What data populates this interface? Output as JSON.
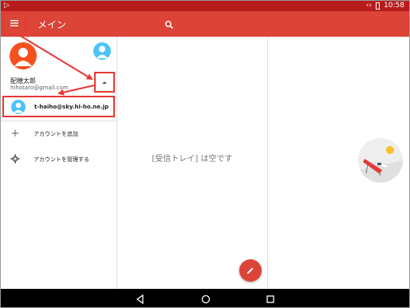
{
  "statusbar": {
    "time": "10:58"
  },
  "appbar": {
    "title": "メイン"
  },
  "drawer": {
    "account_name": "配穂太郎",
    "account_email": "hihotaro@gmail.com",
    "other_account_email": "t-haiho@sky.hi-ho.ne.jp",
    "items": [
      {
        "label": "アカウントを追加",
        "icon": "add-icon"
      },
      {
        "label": "アカウントを管理する",
        "icon": "gear-icon"
      }
    ]
  },
  "main": {
    "empty_text": "[受信トレイ] は空です"
  },
  "colors": {
    "appbar": "#db4437",
    "statusbar": "#b71c1c",
    "avatar_primary": "#f4511e",
    "avatar_secondary": "#4fc3f7",
    "annotation": "#e53935"
  }
}
